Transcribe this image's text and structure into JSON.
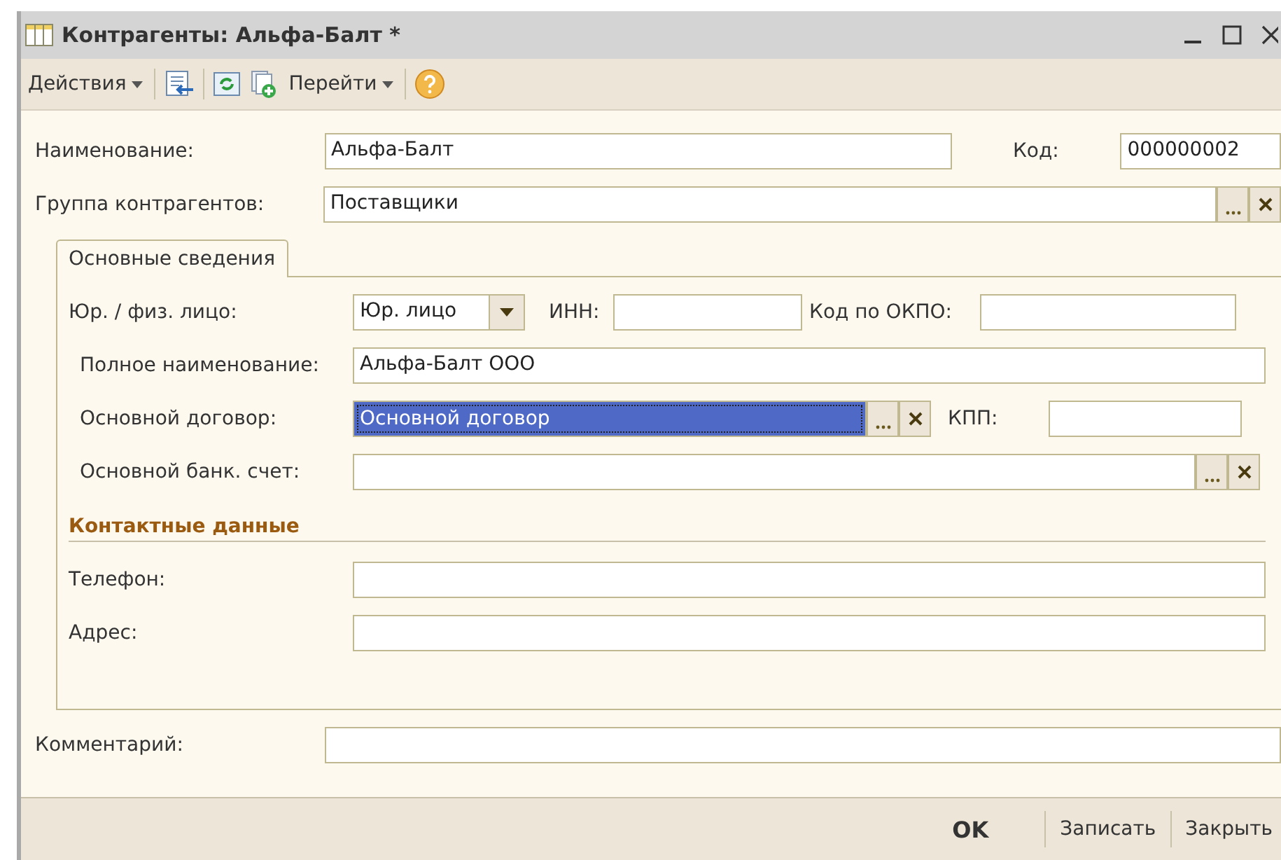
{
  "window": {
    "title": "Контрагенты: Альфа-Балт *"
  },
  "toolbar": {
    "menus": [
      "Действия",
      "Перейти"
    ]
  },
  "header": {
    "name": {
      "label": "Наименование:",
      "value": "Альфа-Балт"
    },
    "code": {
      "label": "Код:",
      "value": "000000002"
    },
    "group": {
      "label": "Группа контрагентов:",
      "value": "Поставщики"
    }
  },
  "tabs": [
    {
      "label": "Основные сведения",
      "selected": true
    }
  ],
  "main": {
    "entity_type": {
      "label": "Юр. / физ. лицо:",
      "value": "Юр. лицо"
    },
    "inn": {
      "label": "ИНН:"
    },
    "okpo": {
      "label": "Код по ОКПО:"
    },
    "full_name": {
      "label": "Полное наименование:",
      "value": "Альфа-Балт ООО"
    },
    "contract": {
      "label": "Основной договор:",
      "value": "Основной договор",
      "selected": true
    },
    "kpp": {
      "label": "КПП:"
    },
    "bank_account": {
      "label": "Основной банк. счет:"
    }
  },
  "contacts": {
    "title": "Контактные данные",
    "phone": {
      "label": "Телефон:"
    },
    "address": {
      "label": "Адрес:"
    }
  },
  "comment": {
    "label": "Комментарий:"
  },
  "buttons": [
    {
      "label": "OK",
      "default": true
    },
    {
      "label": "Записать",
      "default": false
    },
    {
      "label": "Закрыть",
      "default": false
    }
  ]
}
